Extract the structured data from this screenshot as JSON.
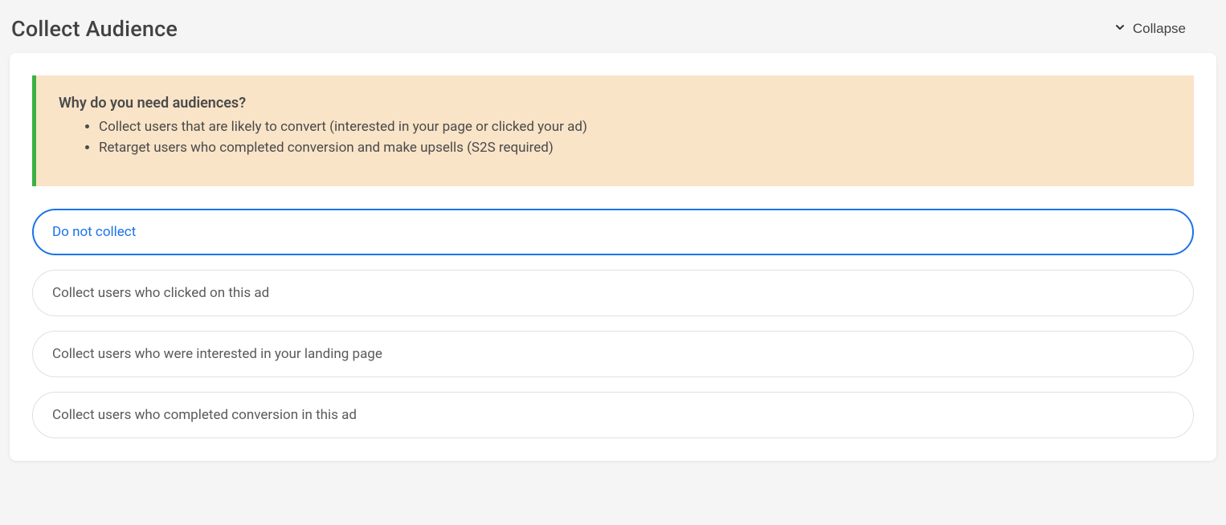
{
  "header": {
    "title": "Collect Audience",
    "collapse_label": "Collapse"
  },
  "info": {
    "title": "Why do you need audiences?",
    "bullets": [
      "Collect users that are likely to convert (interested in your page or clicked your ad)",
      "Retarget users who completed conversion and make upsells (S2S required)"
    ]
  },
  "options": [
    {
      "label": "Do not collect",
      "selected": true
    },
    {
      "label": "Collect users who clicked on this ad",
      "selected": false
    },
    {
      "label": "Collect users who were interested in your landing page",
      "selected": false
    },
    {
      "label": "Collect users who completed conversion in this ad",
      "selected": false
    }
  ]
}
